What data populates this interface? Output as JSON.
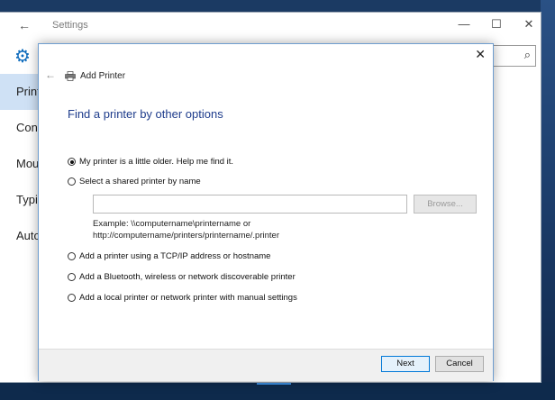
{
  "settings": {
    "back_glyph": "←",
    "title": "Settings",
    "window_controls": {
      "minimize": "—",
      "maximize": "☐",
      "close": "✕"
    },
    "gear_icon": "⚙",
    "search_icon": "⌕",
    "nav_items": [
      "Printers",
      "Con",
      "Mou",
      "Typi",
      "Auto"
    ]
  },
  "dialog": {
    "close_glyph": "✕",
    "back_glyph": "←",
    "title": "Add Printer",
    "heading": "Find a printer by other options",
    "options": {
      "older": "My printer is a little older. Help me find it.",
      "shared": "Select a shared printer by name",
      "tcpip": "Add a printer using a TCP/IP address or hostname",
      "bluetooth": "Add a Bluetooth, wireless or network discoverable printer",
      "local": "Add a local printer or network printer with manual settings"
    },
    "selected_option": "older",
    "shared_input_value": "",
    "browse_label": "Browse...",
    "example_line1": "Example: \\\\computername\\printername or",
    "example_line2": "http://computername/printers/printername/.printer",
    "next_label": "Next",
    "cancel_label": "Cancel"
  }
}
